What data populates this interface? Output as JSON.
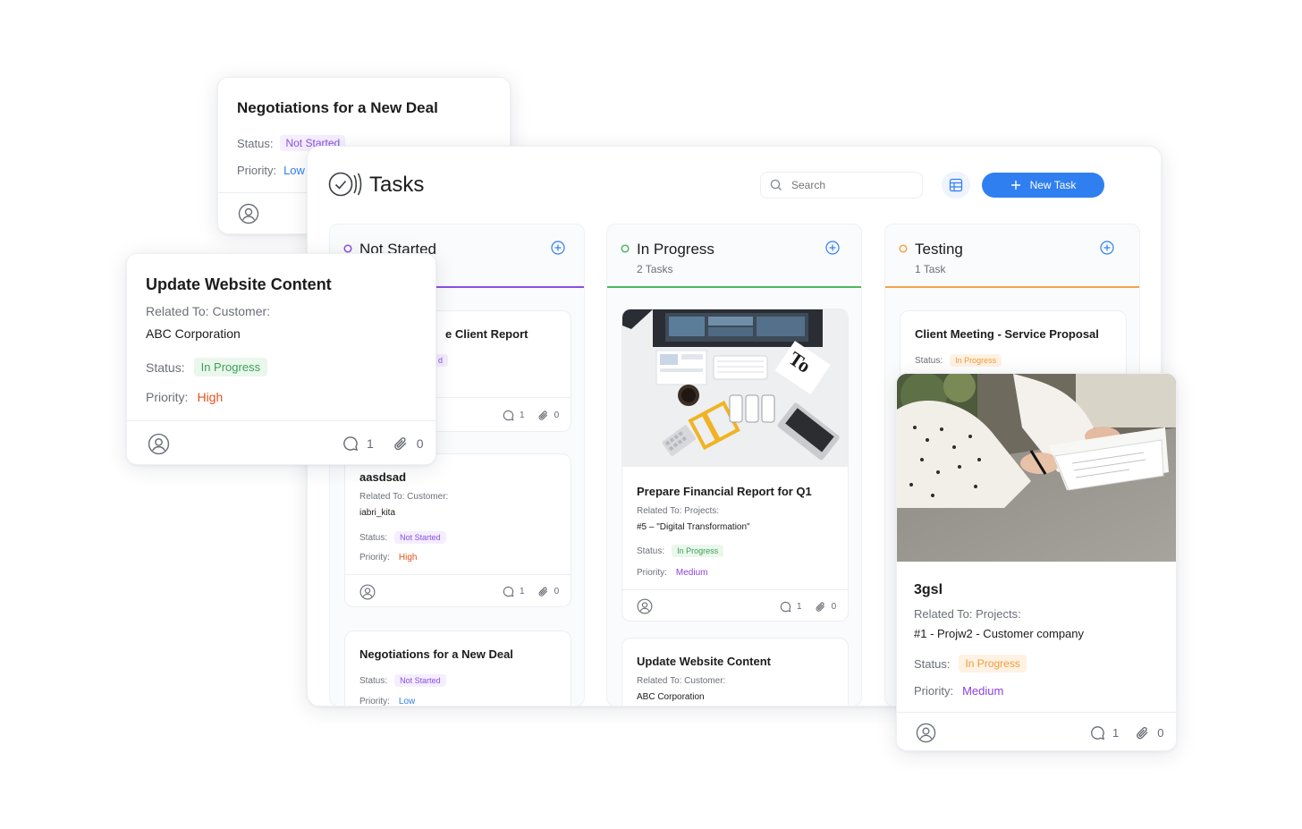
{
  "app": {
    "title": "Tasks",
    "search_placeholder": "Search",
    "new_task_label": "New Task"
  },
  "colors": {
    "accent": "#2f7ff0",
    "not_started": "#8b4fe4",
    "in_progress": "#4cb860",
    "testing": "#f3a548"
  },
  "columns": [
    {
      "title": "Not Started",
      "count": ""
    },
    {
      "title": "In Progress",
      "count": "2 Tasks"
    },
    {
      "title": "Testing",
      "count": "1 Task"
    }
  ],
  "cards": {
    "ns_1": {
      "title": "e Client Report",
      "status": "d",
      "comments": "1",
      "attachments": "0"
    },
    "ns_2": {
      "title": "aasdsad",
      "related_label": "Related To: Customer:",
      "related_value": "iabri_kita",
      "status_label": "Status:",
      "status": "Not Started",
      "priority_label": "Priority:",
      "priority": "High",
      "comments": "1",
      "attachments": "0"
    },
    "ns_3": {
      "title": "Negotiations for a New Deal",
      "status_label": "Status:",
      "status": "Not Started",
      "priority_label": "Priority:",
      "priority": "Low"
    },
    "ip_1": {
      "title": "Prepare Financial Report for Q1",
      "related_label": "Related To: Projects:",
      "related_value": "#5 – \"Digital Transformation\"",
      "status_label": "Status:",
      "status": "In Progress",
      "priority_label": "Priority:",
      "priority": "Medium",
      "comments": "1",
      "attachments": "0"
    },
    "ip_2": {
      "title": "Update Website Content",
      "related_label": "Related To: Customer:",
      "related_value": "ABC Corporation"
    },
    "t_1": {
      "title": "Client Meeting - Service Proposal",
      "status_label": "Status:",
      "status": "In Progress"
    }
  },
  "float_negotiations": {
    "title": "Negotiations for a New Deal",
    "status_label": "Status:",
    "status": "Not Started",
    "priority_label": "Priority:",
    "priority": "Low"
  },
  "float_update": {
    "title": "Update Website Content",
    "related_label": "Related To: Customer:",
    "related_value": "ABC Corporation",
    "status_label": "Status:",
    "status": "In Progress",
    "priority_label": "Priority:",
    "priority": "High",
    "comments": "1",
    "attachments": "0"
  },
  "float_3gsl": {
    "title": "3gsl",
    "related_label": "Related To: Projects:",
    "related_value": "#1 - Projw2 - Customer company",
    "status_label": "Status:",
    "status": "In Progress",
    "priority_label": "Priority:",
    "priority": "Medium",
    "comments": "1",
    "attachments": "0"
  }
}
